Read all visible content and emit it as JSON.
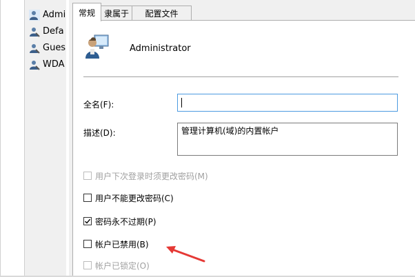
{
  "users_list": {
    "items": [
      {
        "label": "Admi",
        "icon": "user-icon"
      },
      {
        "label": "Defa",
        "icon": "user-icon"
      },
      {
        "label": "Gues",
        "icon": "user-icon"
      },
      {
        "label": "WDA",
        "icon": "user-icon"
      }
    ]
  },
  "tabs": [
    {
      "label": "常规",
      "active": true
    },
    {
      "label": "隶属于",
      "active": false
    },
    {
      "label": "配置文件",
      "active": false
    }
  ],
  "general": {
    "account_name": "Administrator",
    "full_name_label": "全名(F):",
    "full_name_value": "",
    "description_label": "描述(D):",
    "description_value": "管理计算机(域)的内置帐户"
  },
  "options": {
    "must_change_password": {
      "label": "用户下次登录时须更改密码(M)",
      "checked": false,
      "disabled": true
    },
    "cannot_change_password": {
      "label": "用户不能更改密码(C)",
      "checked": false,
      "disabled": false
    },
    "password_never_expires": {
      "label": "密码永不过期(P)",
      "checked": true,
      "disabled": false
    },
    "account_disabled": {
      "label": "帐户已禁用(B)",
      "checked": false,
      "disabled": false
    },
    "account_locked": {
      "label": "帐户已锁定(O)",
      "checked": false,
      "disabled": true
    }
  },
  "colors": {
    "annotation_arrow": "#e53935",
    "focus_border": "#4a9ae0",
    "dialog_bg": "#f0f0f0"
  }
}
